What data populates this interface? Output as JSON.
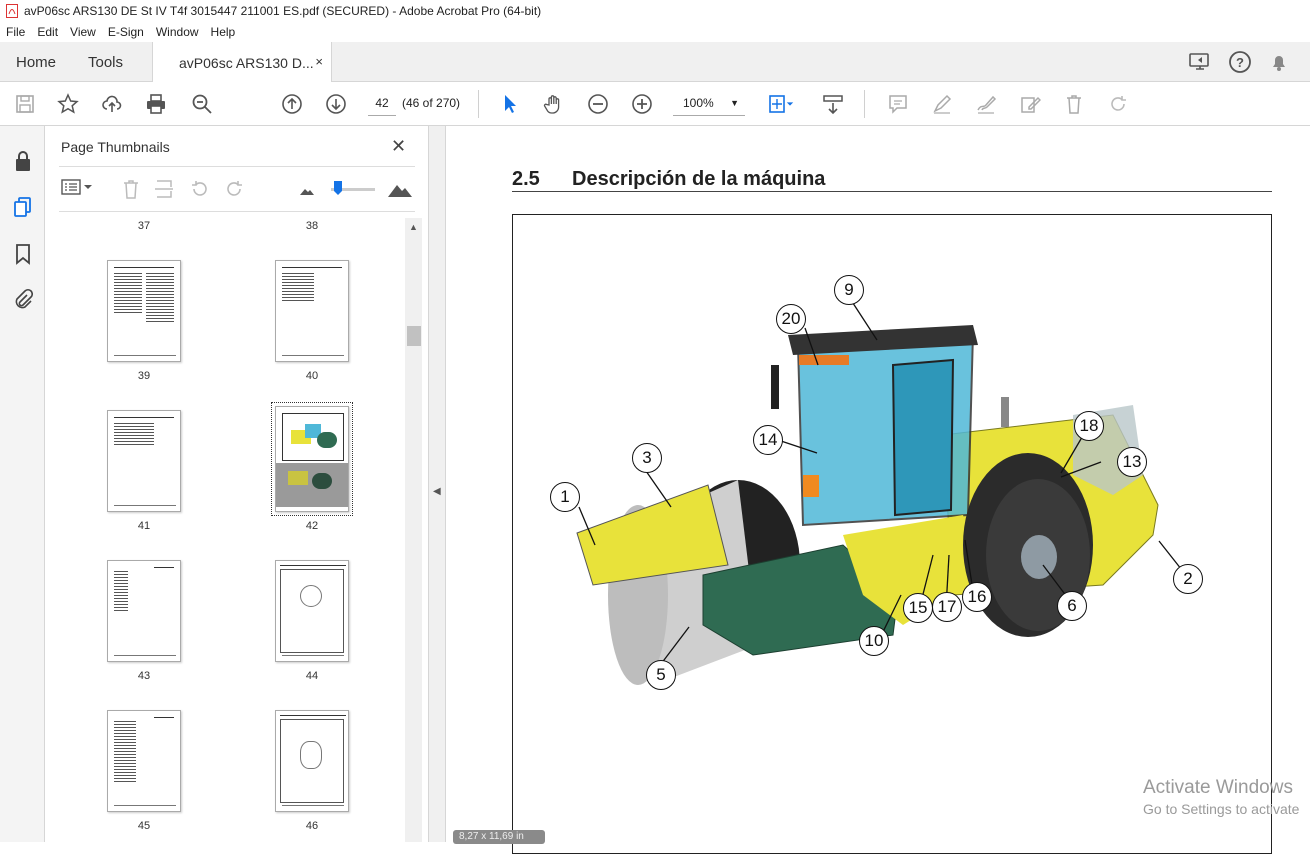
{
  "window": {
    "title": "avP06sc ARS130 DE St IV T4f 3015447 211001 ES.pdf (SECURED) - Adobe Acrobat Pro (64-bit)"
  },
  "menu": [
    "File",
    "Edit",
    "View",
    "E-Sign",
    "Window",
    "Help"
  ],
  "tabs": {
    "home": "Home",
    "tools": "Tools",
    "doc": "avP06sc ARS130 D...",
    "close": "×"
  },
  "toolbar": {
    "page_current": "42",
    "page_count": "(46 of 270)",
    "zoom": "100%"
  },
  "thumbnails_panel": {
    "title": "Page Thumbnails",
    "close": "✕",
    "pages": [
      "37",
      "38",
      "39",
      "40",
      "41",
      "42",
      "43",
      "44",
      "45",
      "46"
    ],
    "selected": "42"
  },
  "document": {
    "section_number": "2.5",
    "section_title": "Descripción de la máquina",
    "callouts": [
      "1",
      "2",
      "3",
      "5",
      "6",
      "9",
      "10",
      "13",
      "14",
      "15",
      "16",
      "17",
      "18",
      "20"
    ]
  },
  "overlay": {
    "activate_title": "Activate Windows",
    "activate_sub": "Go to Settings to activate",
    "page_size": "8,27 x 11,69 in"
  },
  "colors": {
    "machine_yellow": "#e8e23a",
    "machine_green": "#2f6b52",
    "cab_blue": "#4fb8d8",
    "drum_grey": "#cfcfcf"
  }
}
